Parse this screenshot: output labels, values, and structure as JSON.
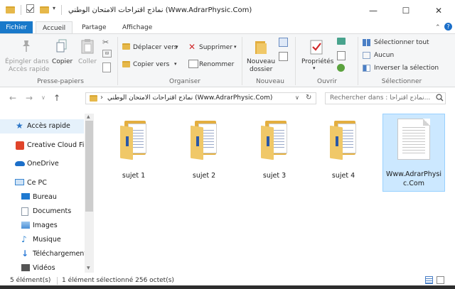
{
  "window": {
    "title": "نماذج اقتراحات الامتحان الوطني (Www.AdrarPhysic.Com)",
    "minimize_glyph": "—",
    "maximize_glyph": "☐",
    "close_glyph": "✕"
  },
  "ribbon_tabs": [
    {
      "label": "Fichier"
    },
    {
      "label": "Accueil"
    },
    {
      "label": "Partage"
    },
    {
      "label": "Affichage"
    }
  ],
  "ribbon": {
    "pin_label_1": "Épingler dans",
    "pin_label_2": "Accès rapide",
    "copy_label": "Copier",
    "paste_label": "Coller",
    "group_clipboard": "Presse-papiers",
    "move_label": "Déplacer vers",
    "copyto_label": "Copier vers",
    "delete_label": "Supprimer",
    "rename_label": "Renommer",
    "group_organize": "Organiser",
    "newfolder_label_1": "Nouveau",
    "newfolder_label_2": "dossier",
    "group_new": "Nouveau",
    "properties_label": "Propriétés",
    "group_open": "Ouvrir",
    "select_all": "Sélectionner tout",
    "select_none": "Aucun",
    "invert_selection": "Inverser la sélection",
    "group_select": "Sélectionner"
  },
  "address": {
    "path": "نماذج اقتراحات الامتحان الوطني (Www.AdrarPhysic.Com)",
    "search_placeholder": "Rechercher dans : نماذج اقتراحا..."
  },
  "nav_items": [
    {
      "label": "Accès rapide",
      "icon": "star-icon",
      "color": "#2b75c7"
    },
    {
      "label": "Creative Cloud Fil",
      "icon": "creative-cloud-icon",
      "color": "#e0442a"
    },
    {
      "label": "OneDrive",
      "icon": "cloud-icon",
      "color": "#1b6fc9"
    },
    {
      "label": "Ce PC",
      "icon": "computer-icon",
      "color": "#3a86d0"
    },
    {
      "label": "Bureau",
      "icon": "desktop-icon",
      "color": "#1f7ad1"
    },
    {
      "label": "Documents",
      "icon": "documents-icon",
      "color": "#8d9aa8"
    },
    {
      "label": "Images",
      "icon": "images-icon",
      "color": "#4a8fd6"
    },
    {
      "label": "Musique",
      "icon": "music-icon",
      "color": "#2e84d1"
    },
    {
      "label": "Téléchargement",
      "icon": "download-icon",
      "color": "#2e7bd6"
    },
    {
      "label": "Vidéos",
      "icon": "video-icon",
      "color": "#555555"
    }
  ],
  "files": [
    {
      "name": "sujet 1",
      "type": "folder"
    },
    {
      "name": "sujet 2",
      "type": "folder"
    },
    {
      "name": "sujet 3",
      "type": "folder"
    },
    {
      "name": "sujet 4",
      "type": "folder"
    },
    {
      "name_line1": "Www.AdrarPhysi",
      "name_line2": "c.Com",
      "type": "file",
      "selected": true
    }
  ],
  "status": {
    "count": "5 élément(s)",
    "selected": "1 élément sélectionné  256 octet(s)"
  },
  "colors": {
    "accent": "#1979ca",
    "selection": "#cce8ff",
    "folder": "#e3ae3f"
  }
}
